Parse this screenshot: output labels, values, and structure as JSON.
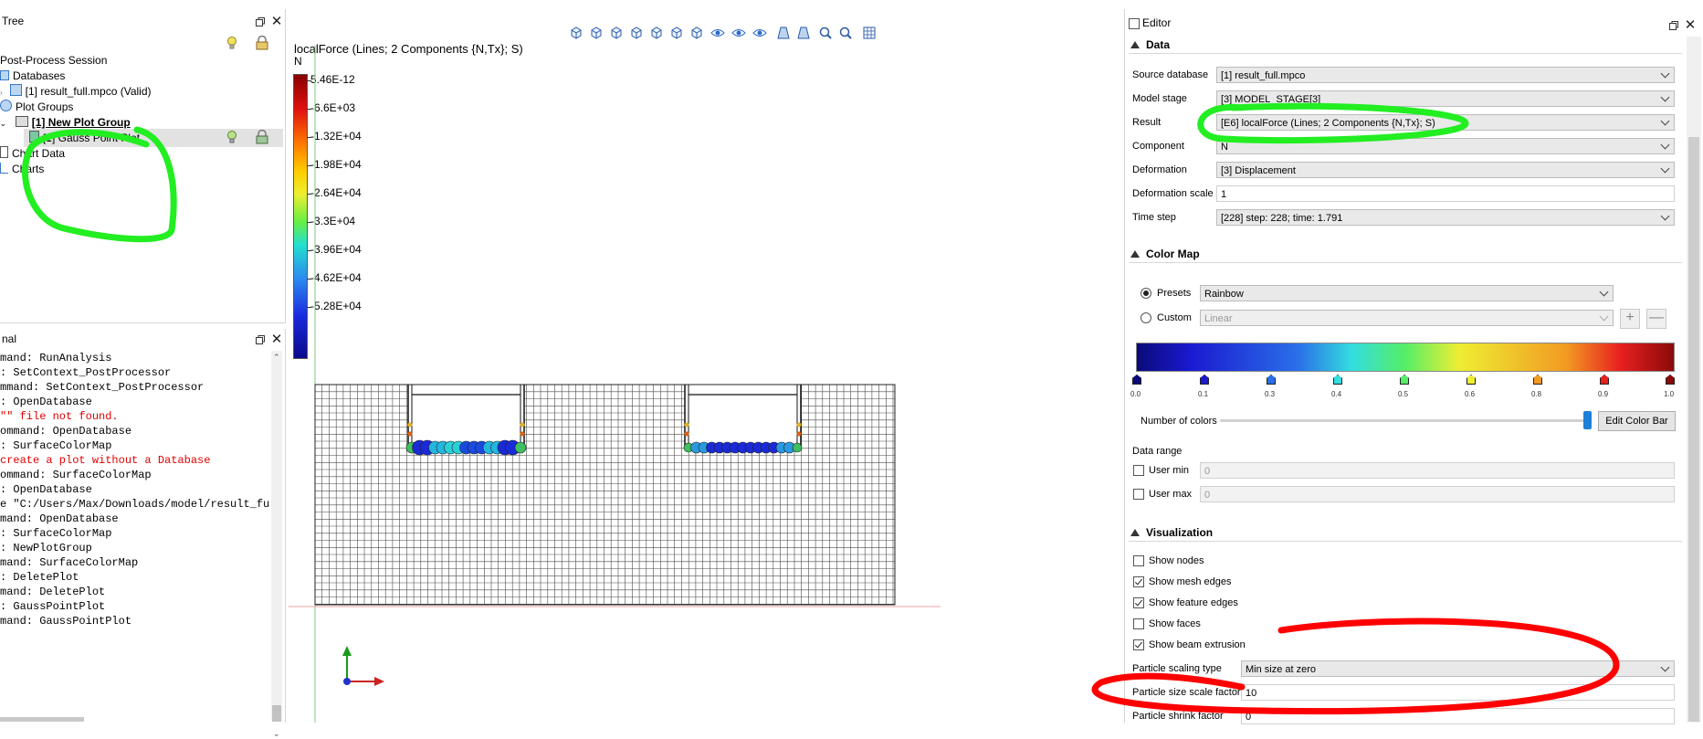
{
  "tree_panel": {
    "title": "Tree",
    "items": [
      {
        "label": "Post-Process Session"
      },
      {
        "label": "Databases"
      },
      {
        "label": "[1] result_full.mpco (Valid)"
      },
      {
        "label": "Plot Groups"
      },
      {
        "label": "[1] New Plot Group"
      },
      {
        "label": "[1] Gauss Point Plot"
      },
      {
        "label": "Chart Data"
      },
      {
        "label": "Charts"
      }
    ]
  },
  "terminal_panel": {
    "title": "nal",
    "lines": [
      {
        "text": "mand: RunAnalysis",
        "error": false
      },
      {
        "text": ": SetContext_PostProcessor",
        "error": false
      },
      {
        "text": "mmand: SetContext_PostProcessor",
        "error": false
      },
      {
        "text": ": OpenDatabase",
        "error": false
      },
      {
        "text": "\"\" file not found.",
        "error": true
      },
      {
        "text": "ommand: OpenDatabase",
        "error": false
      },
      {
        "text": ": SurfaceColorMap",
        "error": false
      },
      {
        "text": "create a plot without a Database",
        "error": true
      },
      {
        "text": "ommand: SurfaceColorMap",
        "error": false
      },
      {
        "text": ": OpenDatabase",
        "error": false
      },
      {
        "text": "e \"C:/Users/Max/Downloads/model/result_full.mpco\"",
        "error": false
      },
      {
        "text": "mand: OpenDatabase",
        "error": false
      },
      {
        "text": ": SurfaceColorMap",
        "error": false
      },
      {
        "text": ": NewPlotGroup",
        "error": false
      },
      {
        "text": "mand: SurfaceColorMap",
        "error": false
      },
      {
        "text": ": DeletePlot",
        "error": false
      },
      {
        "text": "mand: DeletePlot",
        "error": false
      },
      {
        "text": ": GaussPointPlot",
        "error": false
      },
      {
        "text": "mand: GaussPointPlot",
        "error": false
      }
    ]
  },
  "viewport": {
    "legend_title": "localForce (Lines; 2 Components {N,Tx}; S)",
    "legend_unit": "N",
    "legend_ticks": [
      "5.46E-12",
      "-6.6E+03",
      "-1.32E+04",
      "-1.98E+04",
      "-2.64E+04",
      "-3.3E+04",
      "-3.96E+04",
      "-4.62E+04",
      "-5.28E+04"
    ],
    "toolbar_icons": [
      "iso-view-icon",
      "front-view-icon",
      "back-view-icon",
      "left-view-icon",
      "right-view-icon",
      "top-view-icon",
      "bottom-view-icon",
      "show-icon",
      "hide-icon",
      "show-all-icon",
      "perspective-icon",
      "parallel-icon",
      "zoom-fit-icon",
      "zoom-window-icon",
      "grid-icon"
    ]
  },
  "editor": {
    "title": "Editor",
    "sections": {
      "data": "Data",
      "color_map": "Color Map",
      "visualization": "Visualization"
    },
    "data": [
      {
        "label": "Source database",
        "value": "[1] result_full.mpco",
        "kind": "combo"
      },
      {
        "label": "Model stage",
        "value": "[3] MODEL_STAGE[3]",
        "kind": "combo"
      },
      {
        "label": "Result",
        "value": "[E6] localForce (Lines; 2 Components {N,Tx}; S)",
        "kind": "combo"
      },
      {
        "label": "Component",
        "value": "N",
        "kind": "combo"
      },
      {
        "label": "Deformation",
        "value": "[3] Displacement",
        "kind": "combo"
      },
      {
        "label": "Deformation scale",
        "value": "1",
        "kind": "field"
      },
      {
        "label": "Time step",
        "value": "[228] step: 228; time: 1.791",
        "kind": "combo"
      }
    ],
    "color_map": {
      "presets_label": "Presets",
      "presets_value": "Rainbow",
      "custom_label": "Custom",
      "custom_value": "Linear",
      "stops": [
        {
          "pos": "0.0",
          "color": "#0a0a7a"
        },
        {
          "pos": "0.1",
          "color": "#1a1ad0"
        },
        {
          "pos": "0.3",
          "color": "#2a6fe8"
        },
        {
          "pos": "0.4",
          "color": "#33dde0"
        },
        {
          "pos": "0.5",
          "color": "#55ee66"
        },
        {
          "pos": "0.6",
          "color": "#eeee33"
        },
        {
          "pos": "0.8",
          "color": "#f29a22"
        },
        {
          "pos": "0.9",
          "color": "#e82020"
        },
        {
          "pos": "1.0",
          "color": "#8a0a0a"
        }
      ],
      "num_colors_label": "Number of colors",
      "edit_color_bar": "Edit Color Bar",
      "data_range_label": "Data range",
      "user_min_label": "User min",
      "user_min_value": "0",
      "user_max_label": "User max",
      "user_max_value": "0"
    },
    "visualization": {
      "show_nodes": "Show nodes",
      "show_mesh_edges": "Show mesh edges",
      "show_feature_edges": "Show feature edges",
      "show_faces": "Show faces",
      "show_beam_extrusion": "Show beam extrusion",
      "particle_scaling_type_label": "Particle scaling type",
      "particle_scaling_type_value": "Min size at zero",
      "particle_size_scale_label": "Particle size scale factor",
      "particle_size_scale_value": "10",
      "particle_shrink_label": "Particle shrink factor",
      "particle_shrink_value": "0"
    }
  },
  "colors": {
    "annotation_green": "#22ee22",
    "annotation_red": "#ff0000",
    "accent_blue": "#1e7fd8",
    "error_red": "#e00000"
  }
}
